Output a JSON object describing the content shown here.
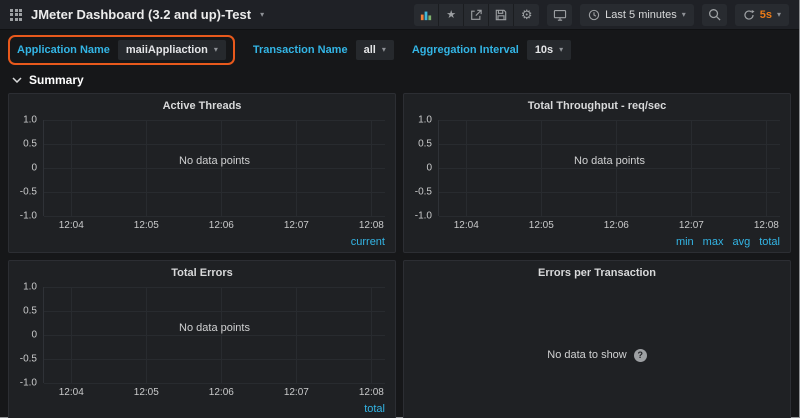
{
  "navbar": {
    "title": "JMeter Dashboard (3.2 and up)-Test",
    "time_range": "Last 5 minutes",
    "refresh_interval": "5s"
  },
  "icons": {
    "star": "★",
    "settings": "⚙",
    "caret": "▾",
    "help": "?"
  },
  "filters": [
    {
      "label": "Application Name",
      "value": "maiiAppliaction"
    },
    {
      "label": "Transaction Name",
      "value": "all"
    },
    {
      "label": "Aggregation Interval",
      "value": "10s"
    }
  ],
  "section": {
    "title": "Summary"
  },
  "panels": [
    {
      "title": "Active Threads",
      "type": "line",
      "empty_text": "No data points",
      "ylim": [
        -1.0,
        1.0
      ],
      "yticks": [
        "1.0",
        "0.5",
        "0",
        "-0.5",
        "-1.0"
      ],
      "xticks": [
        "12:04",
        "12:05",
        "12:06",
        "12:07",
        "12:08"
      ],
      "legend": [
        "current"
      ],
      "series": []
    },
    {
      "title": "Total Throughput - req/sec",
      "type": "line",
      "empty_text": "No data points",
      "ylim": [
        -1.0,
        1.0
      ],
      "yticks": [
        "1.0",
        "0.5",
        "0",
        "-0.5",
        "-1.0"
      ],
      "xticks": [
        "12:04",
        "12:05",
        "12:06",
        "12:07",
        "12:08"
      ],
      "legend": [
        "min",
        "max",
        "avg",
        "total"
      ],
      "series": []
    },
    {
      "title": "Total Errors",
      "type": "line",
      "empty_text": "No data points",
      "ylim": [
        -1.0,
        1.0
      ],
      "yticks": [
        "1.0",
        "0.5",
        "0",
        "-0.5",
        "-1.0"
      ],
      "xticks": [
        "12:04",
        "12:05",
        "12:06",
        "12:07",
        "12:08"
      ],
      "legend": [
        "total"
      ],
      "series": []
    },
    {
      "title": "Errors per Transaction",
      "type": "table",
      "empty_text": "No data to show",
      "legend": [],
      "series": []
    }
  ],
  "colors": {
    "label_blue": "#33b5e5",
    "legend_blue": "#33b5e5",
    "refresh_orange": "#eb7b18",
    "highlight_orange": "#e8591c"
  }
}
